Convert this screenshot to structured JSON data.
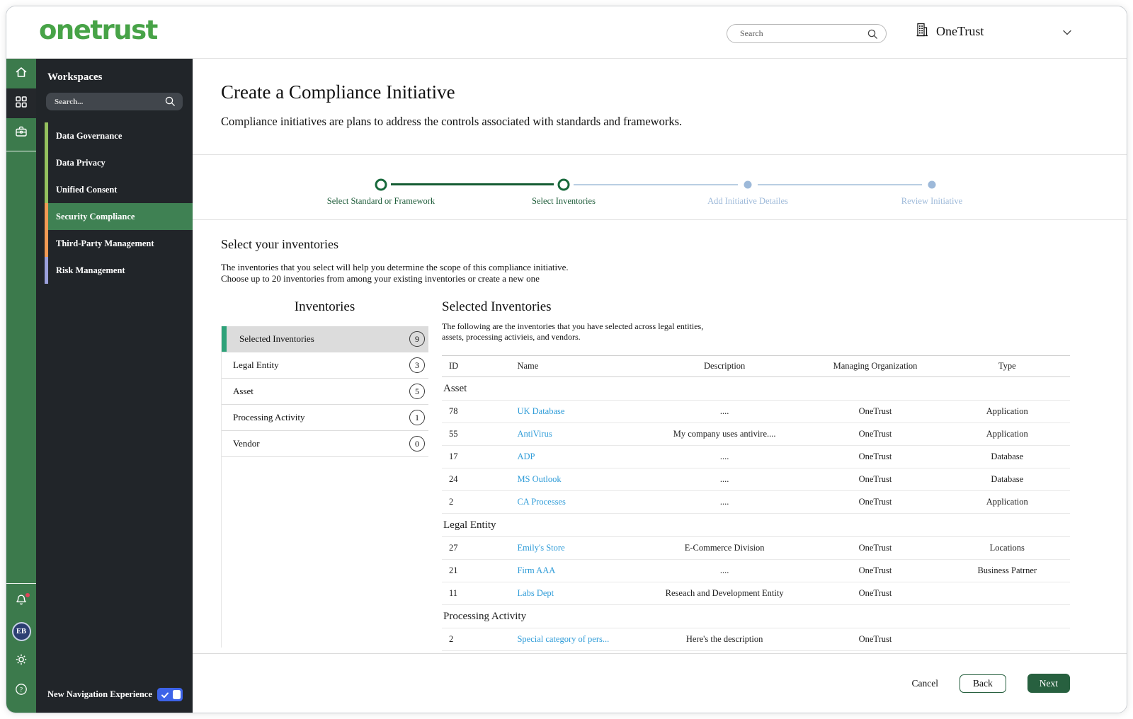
{
  "header": {
    "logo": "onetrust",
    "search_placeholder": "Search",
    "org": "OneTrust"
  },
  "rail": {
    "avatar_initials": "EB"
  },
  "workspaces": {
    "title": "Workspaces",
    "search_placeholder": "Search...",
    "items": [
      {
        "label": "Data Governance",
        "accent": "#94C05E",
        "selected": false
      },
      {
        "label": "Data Privacy",
        "accent": "#94C05E",
        "selected": false
      },
      {
        "label": "Unified Consent",
        "accent": "#94C05E",
        "selected": false
      },
      {
        "label": "Security Compliance",
        "accent": "#F29A54",
        "selected": true
      },
      {
        "label": "Third-Party Management",
        "accent": "#F29A54",
        "selected": false
      },
      {
        "label": "Risk Management",
        "accent": "#9BA0DB",
        "selected": false
      }
    ],
    "footer_label": "New Navigation Experience",
    "toggle_on": true
  },
  "page": {
    "title": "Create a Compliance Initiative",
    "subtitle": "Compliance initiatives are plans to address the controls associated with standards and frameworks.",
    "stepper": [
      {
        "label": "Select Standard or Framework",
        "state": "complete"
      },
      {
        "label": "Select Inventories",
        "state": "current"
      },
      {
        "label": "Add Initiative Detailes",
        "state": "upcoming"
      },
      {
        "label": "Review Initiative",
        "state": "upcoming"
      }
    ],
    "section": {
      "title": "Select your inventories",
      "line1": "The inventories that you select will help you determine the scope of this compliance initiative.",
      "line2": "Choose up to 20 inventories from among your existing inventories or create a new one"
    },
    "inventories": {
      "title": "Inventories",
      "items": [
        {
          "label": "Selected Inventories",
          "count": "9",
          "selected": true
        },
        {
          "label": "Legal Entity",
          "count": "3",
          "selected": false
        },
        {
          "label": "Asset",
          "count": "5",
          "selected": false
        },
        {
          "label": "Processing Activity",
          "count": "1",
          "selected": false
        },
        {
          "label": "Vendor",
          "count": "0",
          "selected": false
        }
      ]
    },
    "selected": {
      "title": "Selected Inventories",
      "desc1": "The following are the inventories that you have selected across legal entities,",
      "desc2": "assets, processing activieis, and vendors.",
      "columns": [
        "ID",
        "Name",
        "Description",
        "Managing Organization",
        "Type"
      ],
      "groups": [
        {
          "label": "Asset",
          "rows": [
            {
              "id": "78",
              "name": "UK Database",
              "description": "....",
              "org": "OneTrust",
              "type": "Application"
            },
            {
              "id": "55",
              "name": "AntiVirus",
              "description": "My company uses antivire....",
              "org": "OneTrust",
              "type": "Application"
            },
            {
              "id": "17",
              "name": "ADP",
              "description": "....",
              "org": "OneTrust",
              "type": "Database"
            },
            {
              "id": "24",
              "name": "MS Outlook",
              "description": "....",
              "org": "OneTrust",
              "type": "Database"
            },
            {
              "id": "2",
              "name": "CA Processes",
              "description": "....",
              "org": "OneTrust",
              "type": "Application"
            }
          ]
        },
        {
          "label": "Legal Entity",
          "rows": [
            {
              "id": "27",
              "name": "Emily's Store",
              "description": "E-Commerce Division",
              "org": "OneTrust",
              "type": "Locations"
            },
            {
              "id": "21",
              "name": "Firm AAA",
              "description": "....",
              "org": "OneTrust",
              "type": "Business Patrner"
            },
            {
              "id": "11",
              "name": "Labs Dept",
              "description": "Reseach and Development Entity",
              "org": "OneTrust",
              "type": ""
            }
          ]
        },
        {
          "label": "Processing Activity",
          "rows": [
            {
              "id": "2",
              "name": "Special category of pers...",
              "description": "Here's the description",
              "org": "OneTrust",
              "type": ""
            }
          ]
        }
      ]
    },
    "actions": {
      "cancel": "Cancel",
      "back": "Back",
      "next": "Next"
    }
  },
  "colors": {
    "brand_green": "#47A347",
    "rail_green": "#3C7A4C",
    "panel_dark": "#212529",
    "selected_workspace_green": "#3F8153",
    "accent_green": "#94C05E",
    "accent_orange": "#F29A54",
    "accent_purple": "#9BA0DB",
    "stepper_green": "#17693B",
    "stepper_inactive_blue": "#9DB9D9",
    "link_blue": "#2F9CD8",
    "toggle_blue": "#3D63E8",
    "button_green": "#27603F",
    "list_accent_teal": "#2EA279",
    "notification_red": "#E0455A",
    "avatar_navy": "#2C3F72"
  },
  "icons": {
    "search-icon": "magnifier glyph",
    "building-icon": "office building glyph",
    "chevron-down-icon": "v chevron",
    "home-icon": "house outline",
    "apps-grid-icon": "four squares",
    "briefcase-icon": "briefcase outline",
    "bell-icon": "notification bell with red dot",
    "gear-icon": "settings gear",
    "help-icon": "question mark circle",
    "check-icon": "white checkmark in toggle"
  }
}
